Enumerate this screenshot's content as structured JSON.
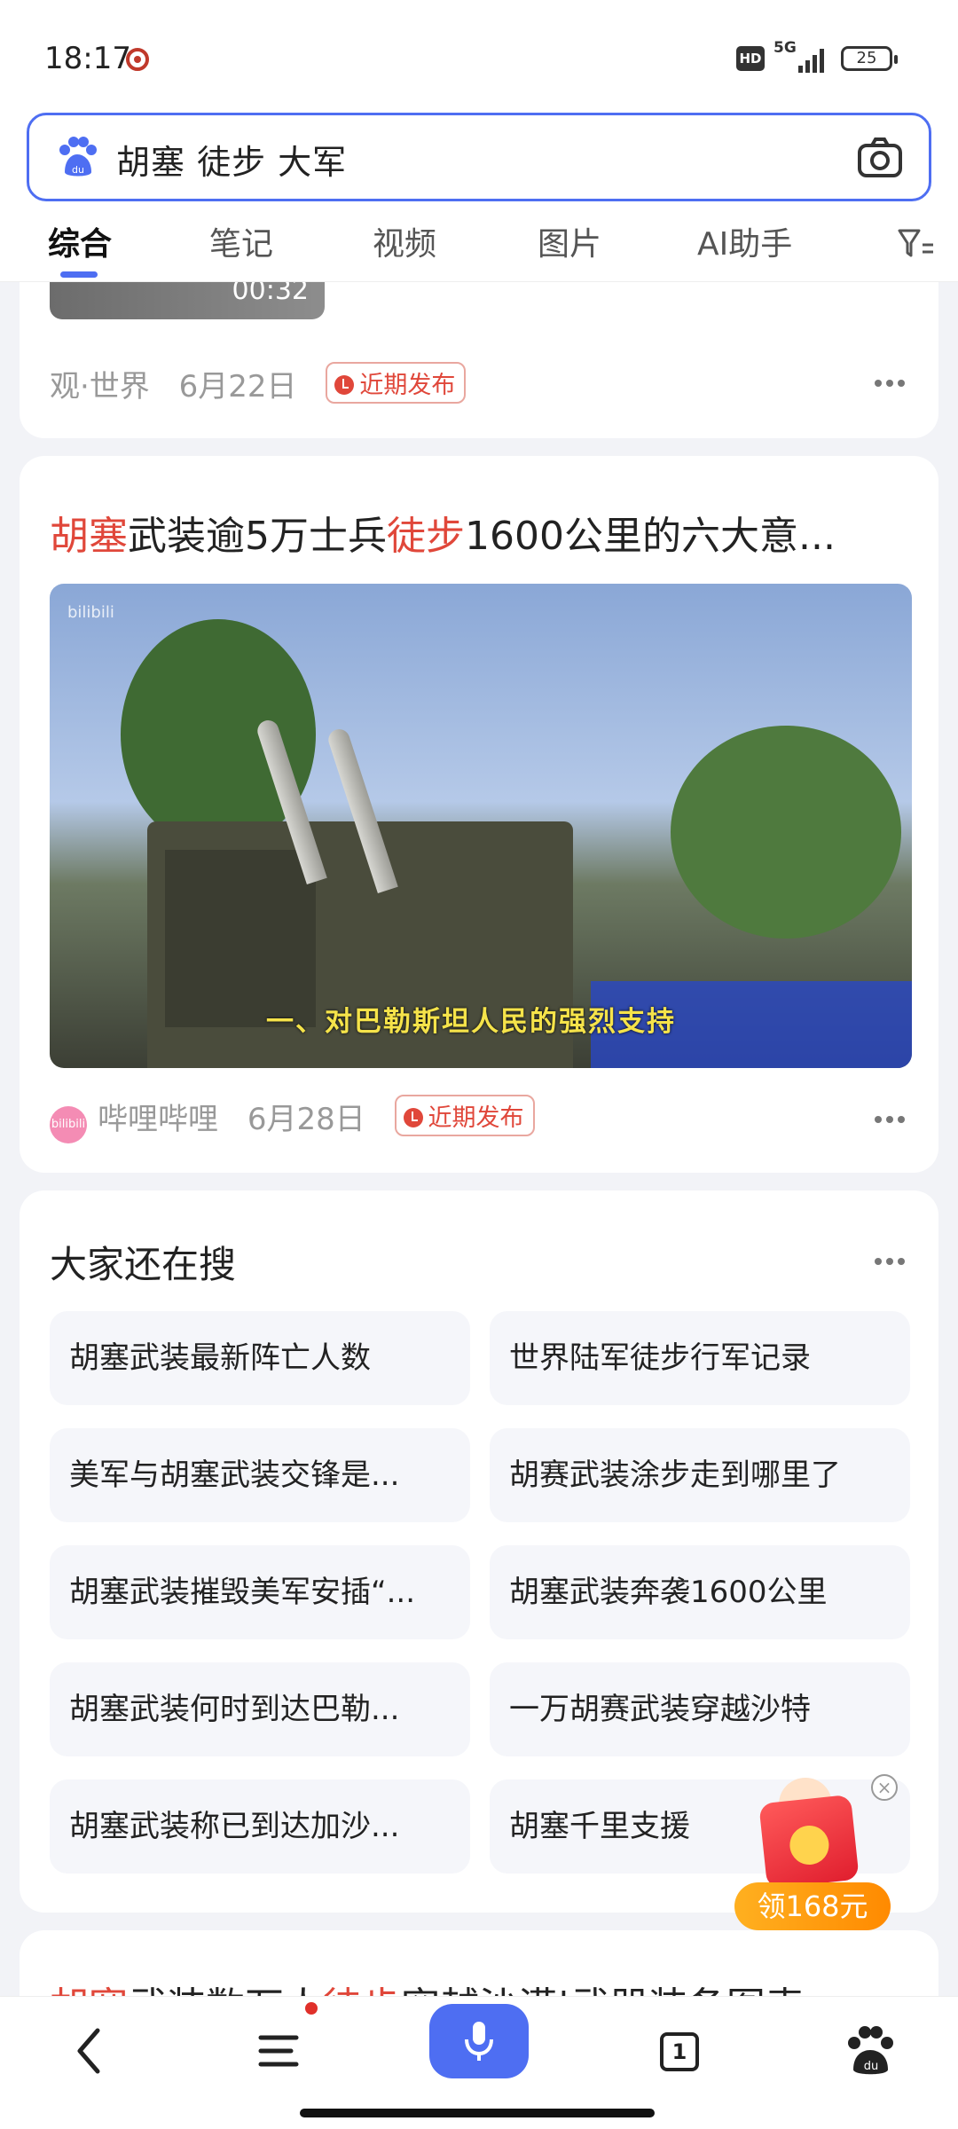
{
  "status_bar": {
    "time": "18:17",
    "network": "5G",
    "hd": "HD",
    "battery": "25"
  },
  "search": {
    "query": "胡塞 徒步 大军"
  },
  "tabs": [
    {
      "label": "综合",
      "active": true
    },
    {
      "label": "笔记"
    },
    {
      "label": "视频"
    },
    {
      "label": "图片"
    },
    {
      "label": "AI助手"
    }
  ],
  "results": [
    {
      "duration": "00:32",
      "source": "观·世界",
      "date": "6月22日",
      "badge": "近期发布"
    },
    {
      "title_parts": [
        "胡塞",
        "武装逾5万士兵",
        "徒步",
        "1600公里的六大意..."
      ],
      "video_subtitle": "一、对巴勒斯坦人民的强烈支持",
      "video_watermark": "bilibili",
      "source": "哔哩哔哩",
      "avatar_text": "bilibili",
      "date": "6月28日",
      "badge": "近期发布"
    }
  ],
  "related": {
    "heading": "大家还在搜",
    "items": [
      "胡塞武装最新阵亡人数",
      "世界陆军徒步行军记录",
      "美军与胡塞武装交锋是...",
      "胡赛武装涂步走到哪里了",
      "胡塞武装摧毁美军安插“...",
      "胡塞武装奔袭1600公里",
      "胡塞武装何时到达巴勒...",
      "一万胡赛武装穿越沙特",
      "胡塞武装称已到达加沙...",
      "胡塞千里支援"
    ]
  },
  "next_result": {
    "title_parts": [
      "胡塞",
      "武装数万人",
      "徒步",
      "穿越沙漠|武器装备图表"
    ]
  },
  "promo": {
    "label": "领168元"
  },
  "bottom_nav": {
    "tab_count": "1"
  },
  "colors": {
    "accent": "#4e6ef2",
    "highlight": "#e0473a"
  }
}
